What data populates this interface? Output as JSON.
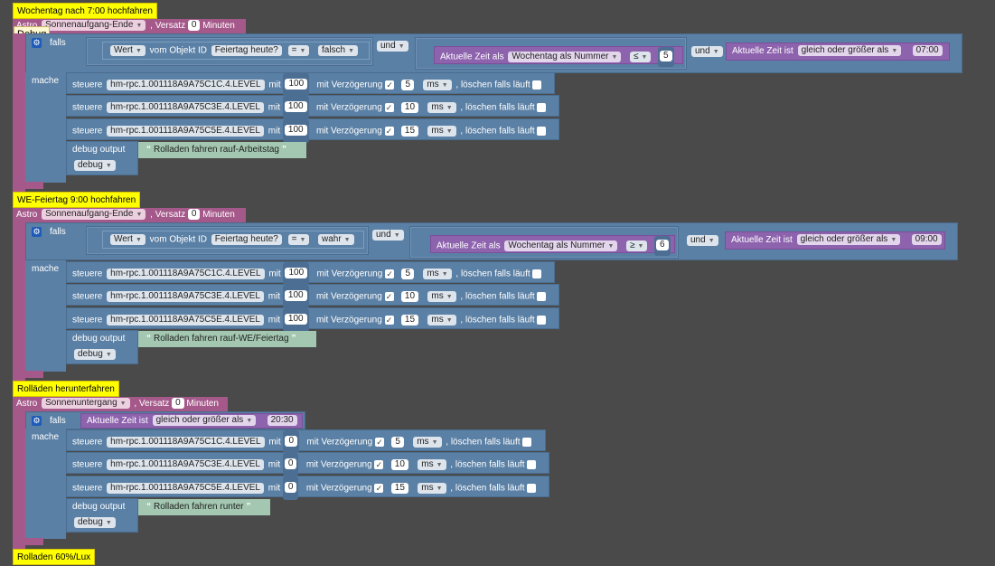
{
  "tooltip": "Debug",
  "common": {
    "falls": "falls",
    "mache": "mache",
    "und": "und",
    "steuere": "steuere",
    "mit": "mit",
    "mit_verzoegerung": "mit Verzögerung",
    "loeschen": ", löschen falls läuft",
    "debug_output": "debug output",
    "debug_level": "debug",
    "astro": "Astro",
    "versatz": ", Versatz",
    "minuten": "Minuten",
    "wert": "Wert",
    "vom_objekt": "vom Objekt ID",
    "aktuelle_zeit_als": "Aktuelle Zeit als",
    "aktuelle_zeit_ist": "Aktuelle Zeit ist",
    "ms": "ms",
    "eq": "=",
    "checkmark": "✓"
  },
  "scripts": [
    {
      "comment": "Wochentag nach 7:00 hochfahren",
      "astro_event": "Sonnenaufgang-Ende",
      "offset": "0",
      "cond1": {
        "object": "Feiertag heute?",
        "op": "=",
        "value": "falsch"
      },
      "cond2": {
        "mode": "Wochentag als Nummer",
        "op": "≤",
        "value": "5"
      },
      "cond3": {
        "mode": "gleich oder größer als",
        "time": "07:00"
      },
      "actions": [
        {
          "obj": "hm-rpc.1.001118A9A75C1C.4.LEVEL",
          "value": "100",
          "delay": "5"
        },
        {
          "obj": "hm-rpc.1.001118A9A75C3E.4.LEVEL",
          "value": "100",
          "delay": "10"
        },
        {
          "obj": "hm-rpc.1.001118A9A75C5E.4.LEVEL",
          "value": "100",
          "delay": "15"
        }
      ],
      "debug_text": "Rolladen fahren rauf-Arbeitstag"
    },
    {
      "comment": "WE-Feiertag 9:00 hochfahren",
      "astro_event": "Sonnenaufgang-Ende",
      "offset": "0",
      "cond1": {
        "object": "Feiertag heute?",
        "op": "=",
        "value": "wahr"
      },
      "cond2": {
        "mode": "Wochentag als Nummer",
        "op": "≥",
        "value": "6"
      },
      "cond3": {
        "mode": "gleich oder größer als",
        "time": "09:00"
      },
      "actions": [
        {
          "obj": "hm-rpc.1.001118A9A75C1C.4.LEVEL",
          "value": "100",
          "delay": "5"
        },
        {
          "obj": "hm-rpc.1.001118A9A75C3E.4.LEVEL",
          "value": "100",
          "delay": "10"
        },
        {
          "obj": "hm-rpc.1.001118A9A75C5E.4.LEVEL",
          "value": "100",
          "delay": "15"
        }
      ],
      "debug_text": "Rolladen fahren rauf-WE/Feiertag"
    },
    {
      "comment": "Rolläden herunterfahren",
      "astro_event": "Sonnenuntergang",
      "offset": "0",
      "cond3": {
        "mode": "gleich oder größer als",
        "time": "20:30"
      },
      "actions": [
        {
          "obj": "hm-rpc.1.001118A9A75C1C.4.LEVEL",
          "value": "0",
          "delay": "5"
        },
        {
          "obj": "hm-rpc.1.001118A9A75C3E.4.LEVEL",
          "value": "0",
          "delay": "10"
        },
        {
          "obj": "hm-rpc.1.001118A9A75C5E.4.LEVEL",
          "value": "0",
          "delay": "15"
        }
      ],
      "debug_text": "Rolladen fahren runter"
    }
  ],
  "last_comment": "Rolladen 60%/Lux"
}
